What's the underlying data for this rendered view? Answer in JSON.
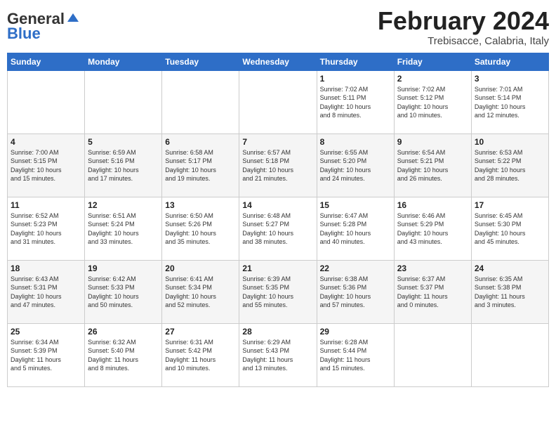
{
  "header": {
    "logo_general": "General",
    "logo_blue": "Blue",
    "month_title": "February 2024",
    "location": "Trebisacce, Calabria, Italy"
  },
  "days_of_week": [
    "Sunday",
    "Monday",
    "Tuesday",
    "Wednesday",
    "Thursday",
    "Friday",
    "Saturday"
  ],
  "weeks": [
    [
      {
        "day": "",
        "info": ""
      },
      {
        "day": "",
        "info": ""
      },
      {
        "day": "",
        "info": ""
      },
      {
        "day": "",
        "info": ""
      },
      {
        "day": "1",
        "info": "Sunrise: 7:02 AM\nSunset: 5:11 PM\nDaylight: 10 hours\nand 8 minutes."
      },
      {
        "day": "2",
        "info": "Sunrise: 7:02 AM\nSunset: 5:12 PM\nDaylight: 10 hours\nand 10 minutes."
      },
      {
        "day": "3",
        "info": "Sunrise: 7:01 AM\nSunset: 5:14 PM\nDaylight: 10 hours\nand 12 minutes."
      }
    ],
    [
      {
        "day": "4",
        "info": "Sunrise: 7:00 AM\nSunset: 5:15 PM\nDaylight: 10 hours\nand 15 minutes."
      },
      {
        "day": "5",
        "info": "Sunrise: 6:59 AM\nSunset: 5:16 PM\nDaylight: 10 hours\nand 17 minutes."
      },
      {
        "day": "6",
        "info": "Sunrise: 6:58 AM\nSunset: 5:17 PM\nDaylight: 10 hours\nand 19 minutes."
      },
      {
        "day": "7",
        "info": "Sunrise: 6:57 AM\nSunset: 5:18 PM\nDaylight: 10 hours\nand 21 minutes."
      },
      {
        "day": "8",
        "info": "Sunrise: 6:55 AM\nSunset: 5:20 PM\nDaylight: 10 hours\nand 24 minutes."
      },
      {
        "day": "9",
        "info": "Sunrise: 6:54 AM\nSunset: 5:21 PM\nDaylight: 10 hours\nand 26 minutes."
      },
      {
        "day": "10",
        "info": "Sunrise: 6:53 AM\nSunset: 5:22 PM\nDaylight: 10 hours\nand 28 minutes."
      }
    ],
    [
      {
        "day": "11",
        "info": "Sunrise: 6:52 AM\nSunset: 5:23 PM\nDaylight: 10 hours\nand 31 minutes."
      },
      {
        "day": "12",
        "info": "Sunrise: 6:51 AM\nSunset: 5:24 PM\nDaylight: 10 hours\nand 33 minutes."
      },
      {
        "day": "13",
        "info": "Sunrise: 6:50 AM\nSunset: 5:26 PM\nDaylight: 10 hours\nand 35 minutes."
      },
      {
        "day": "14",
        "info": "Sunrise: 6:48 AM\nSunset: 5:27 PM\nDaylight: 10 hours\nand 38 minutes."
      },
      {
        "day": "15",
        "info": "Sunrise: 6:47 AM\nSunset: 5:28 PM\nDaylight: 10 hours\nand 40 minutes."
      },
      {
        "day": "16",
        "info": "Sunrise: 6:46 AM\nSunset: 5:29 PM\nDaylight: 10 hours\nand 43 minutes."
      },
      {
        "day": "17",
        "info": "Sunrise: 6:45 AM\nSunset: 5:30 PM\nDaylight: 10 hours\nand 45 minutes."
      }
    ],
    [
      {
        "day": "18",
        "info": "Sunrise: 6:43 AM\nSunset: 5:31 PM\nDaylight: 10 hours\nand 47 minutes."
      },
      {
        "day": "19",
        "info": "Sunrise: 6:42 AM\nSunset: 5:33 PM\nDaylight: 10 hours\nand 50 minutes."
      },
      {
        "day": "20",
        "info": "Sunrise: 6:41 AM\nSunset: 5:34 PM\nDaylight: 10 hours\nand 52 minutes."
      },
      {
        "day": "21",
        "info": "Sunrise: 6:39 AM\nSunset: 5:35 PM\nDaylight: 10 hours\nand 55 minutes."
      },
      {
        "day": "22",
        "info": "Sunrise: 6:38 AM\nSunset: 5:36 PM\nDaylight: 10 hours\nand 57 minutes."
      },
      {
        "day": "23",
        "info": "Sunrise: 6:37 AM\nSunset: 5:37 PM\nDaylight: 11 hours\nand 0 minutes."
      },
      {
        "day": "24",
        "info": "Sunrise: 6:35 AM\nSunset: 5:38 PM\nDaylight: 11 hours\nand 3 minutes."
      }
    ],
    [
      {
        "day": "25",
        "info": "Sunrise: 6:34 AM\nSunset: 5:39 PM\nDaylight: 11 hours\nand 5 minutes."
      },
      {
        "day": "26",
        "info": "Sunrise: 6:32 AM\nSunset: 5:40 PM\nDaylight: 11 hours\nand 8 minutes."
      },
      {
        "day": "27",
        "info": "Sunrise: 6:31 AM\nSunset: 5:42 PM\nDaylight: 11 hours\nand 10 minutes."
      },
      {
        "day": "28",
        "info": "Sunrise: 6:29 AM\nSunset: 5:43 PM\nDaylight: 11 hours\nand 13 minutes."
      },
      {
        "day": "29",
        "info": "Sunrise: 6:28 AM\nSunset: 5:44 PM\nDaylight: 11 hours\nand 15 minutes."
      },
      {
        "day": "",
        "info": ""
      },
      {
        "day": "",
        "info": ""
      }
    ]
  ]
}
